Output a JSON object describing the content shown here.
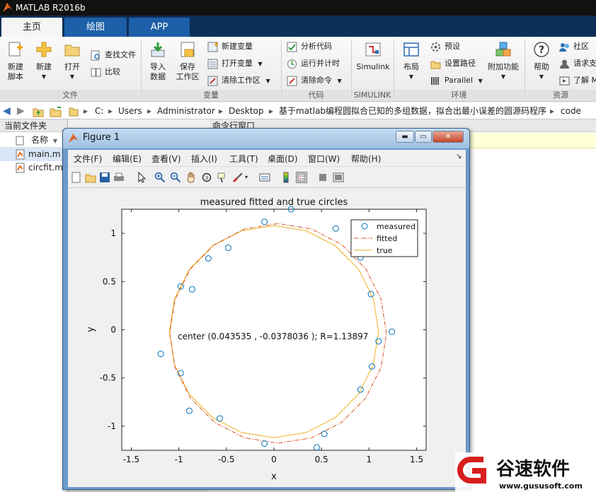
{
  "app": {
    "title": "MATLAB R2016b"
  },
  "tabs": [
    {
      "label": "主页"
    },
    {
      "label": "绘图"
    },
    {
      "label": "APP"
    }
  ],
  "ribbon": {
    "new_script": "新建\n脚本",
    "new": "新建",
    "open": "打开",
    "find_files": "查找文件",
    "compare": "比较",
    "import_data": "导入\n数据",
    "save_workspace": "保存\n工作区",
    "new_variable": "新建变量",
    "open_variable": "打开变量",
    "clear_workspace": "清除工作区",
    "analyze_code": "分析代码",
    "run_and_time": "运行并计时",
    "clear_commands": "清除命令",
    "simulink": "Simulink",
    "layout": "布局",
    "preferences": "预设",
    "set_path": "设置路径",
    "parallel": "Parallel",
    "addons": "附加功能",
    "help": "帮助",
    "community": "社区",
    "request_support": "请求支",
    "learn": "了解 M",
    "groups": {
      "file": "文件",
      "variable": "变量",
      "code": "代码",
      "simulink": "SIMULINK",
      "environment": "环境",
      "resources": "资源"
    }
  },
  "address": {
    "segments": [
      "C:",
      "Users",
      "Administrator",
      "Desktop",
      "基于matlab编程圆拟合已知的多组数据，拟合出最小误差的圆源码程序",
      "code"
    ]
  },
  "current_folder": {
    "title": "当前文件夹",
    "column": "名称",
    "files": [
      {
        "name": "main.m"
      },
      {
        "name": "circfit.m"
      }
    ]
  },
  "command_window": {
    "title": "命令行窗口"
  },
  "figure": {
    "title": "Figure 1",
    "menu": [
      "文件(F)",
      "编辑(E)",
      "查看(V)",
      "插入(I)",
      "工具(T)",
      "桌面(D)",
      "窗口(W)",
      "帮助(H)"
    ]
  },
  "chart_data": {
    "type": "scatter",
    "title": "measured fitted and true circles",
    "xlabel": "x",
    "ylabel": "y",
    "xlim": [
      -1.6,
      1.6
    ],
    "ylim": [
      -1.25,
      1.25
    ],
    "xticks": [
      "-1.5",
      "-1",
      "-0.5",
      "0",
      "0.5",
      "1",
      "1.5"
    ],
    "yticks": [
      "1",
      "0.5",
      "0",
      "-0.5",
      "-1"
    ],
    "xtick_values": [
      -1.5,
      -1,
      -0.5,
      0,
      0.5,
      1,
      1.5
    ],
    "ytick_values": [
      1,
      0.5,
      0,
      -0.5,
      -1
    ],
    "annotation": "center (0.043535 , -0.0378036 );  R=1.13897",
    "legend": {
      "placement": "top-right",
      "entries": [
        "measured",
        "fitted",
        "true"
      ]
    },
    "colors": {
      "measured": "#0072bd",
      "fitted": "#d95319",
      "true": "#edb120"
    },
    "measured": [
      {
        "x": 0.18,
        "y": 1.25
      },
      {
        "x": 0.65,
        "y": 1.05
      },
      {
        "x": -0.1,
        "y": 1.12
      },
      {
        "x": -0.48,
        "y": 0.85
      },
      {
        "x": -0.69,
        "y": 0.74
      },
      {
        "x": 0.91,
        "y": 0.75
      },
      {
        "x": -0.98,
        "y": 0.45
      },
      {
        "x": -0.86,
        "y": 0.42
      },
      {
        "x": 1.02,
        "y": 0.37
      },
      {
        "x": 1.24,
        "y": -0.02
      },
      {
        "x": 1.1,
        "y": -0.12
      },
      {
        "x": -1.19,
        "y": -0.25
      },
      {
        "x": 1.03,
        "y": -0.38
      },
      {
        "x": -0.98,
        "y": -0.45
      },
      {
        "x": 0.91,
        "y": -0.62
      },
      {
        "x": -0.89,
        "y": -0.84
      },
      {
        "x": -0.57,
        "y": -0.92
      },
      {
        "x": 0.53,
        "y": -1.08
      },
      {
        "x": -0.1,
        "y": -1.18
      },
      {
        "x": 0.45,
        "y": -1.22
      }
    ],
    "fit_center": [
      0.043535,
      -0.0378036
    ],
    "fit_radius": 1.13897,
    "true_center": [
      0.0,
      -0.02
    ],
    "true_radius": 1.1
  },
  "watermark": {
    "brand": "谷速软件",
    "url": "www.gususoft.com"
  }
}
